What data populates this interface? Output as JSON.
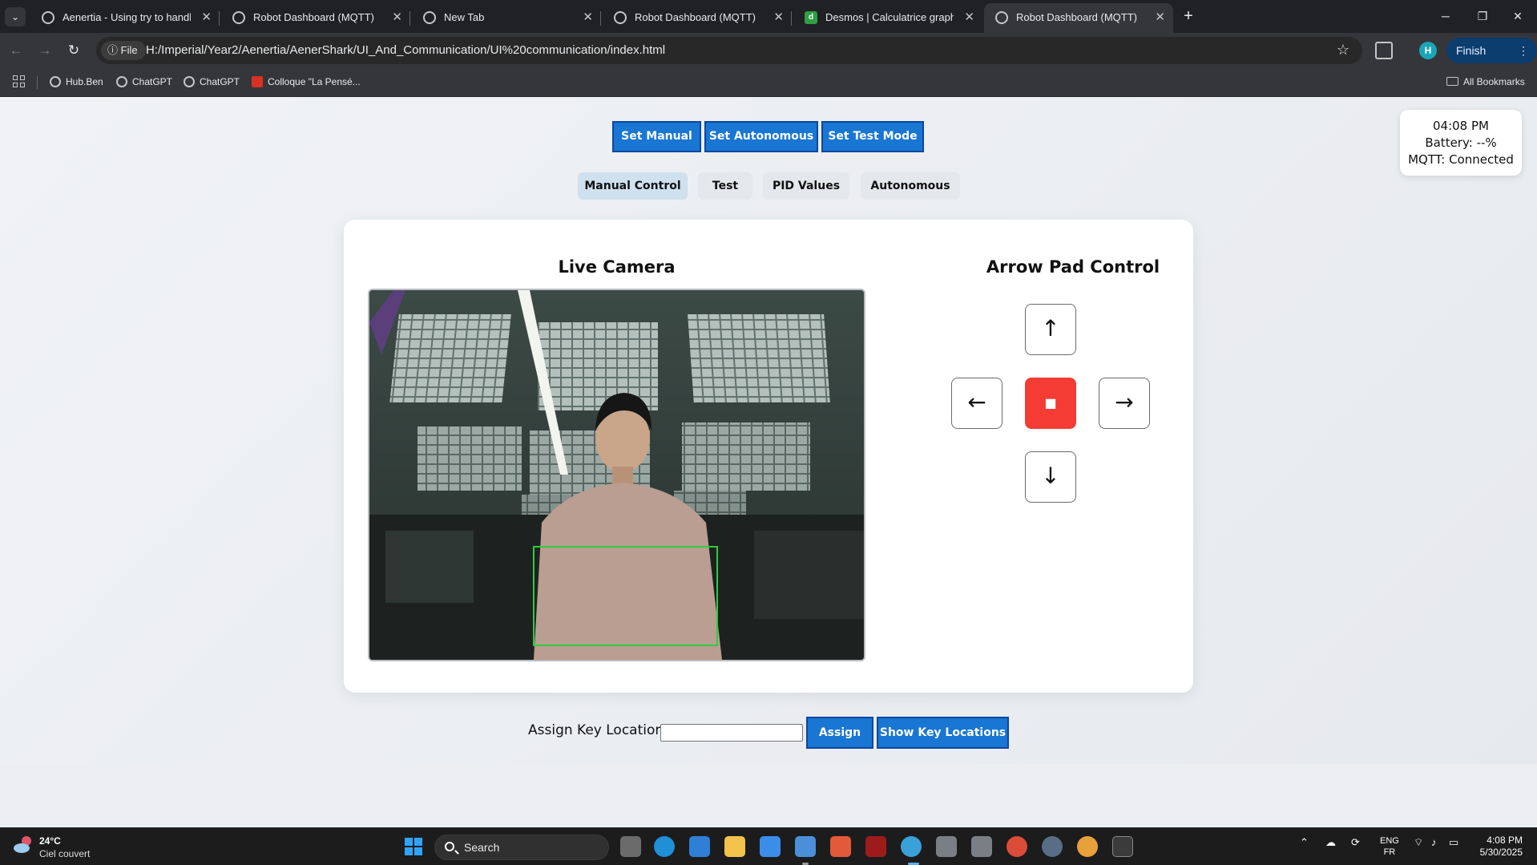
{
  "browser": {
    "tabs": [
      {
        "title": "Aenertia - Using try to handle e",
        "favicon": "chatgpt-icon",
        "active": false
      },
      {
        "title": "Robot Dashboard (MQTT)",
        "favicon": "globe-icon",
        "active": false
      },
      {
        "title": "New Tab",
        "favicon": "chrome-icon",
        "active": false
      },
      {
        "title": "Robot Dashboard (MQTT)",
        "favicon": "globe-icon",
        "active": false
      },
      {
        "title": "Desmos | Calculatrice graphique",
        "favicon": "desmos-icon",
        "active": false
      },
      {
        "title": "Robot Dashboard (MQTT)",
        "favicon": "globe-icon",
        "active": true
      }
    ],
    "file_chip": "File",
    "url": "H:/Imperial/Year2/Aenertia/AenerShark/UI_And_Communication/UI%20communication/index.html",
    "profile_initial": "H",
    "update_button": "Finish update",
    "bookmarks": [
      "Hub.Ben",
      "ChatGPT",
      "ChatGPT",
      "Colloque \"La Pensé..."
    ],
    "all_bookmarks": "All Bookmarks"
  },
  "dashboard": {
    "mode_buttons": [
      "Set Manual",
      "Set Autonomous",
      "Set Test Mode"
    ],
    "tabs": [
      "Manual Control",
      "Test",
      "PID Values",
      "Autonomous"
    ],
    "active_tab": "Manual Control",
    "status": {
      "time": "04:08 PM",
      "battery": "Battery: --%",
      "mqtt": "MQTT: Connected"
    },
    "camera_title": "Live Camera",
    "arrow_title": "Arrow Pad Control",
    "arrows": {
      "up": "↑",
      "left": "←",
      "stop": "■",
      "right": "→",
      "down": "↓"
    },
    "assign_label": "Assign Key Location:",
    "assign_input_value": "",
    "assign_button": "Assign",
    "show_keys_button": "Show Key Locations",
    "colors": {
      "primary_button": "#1976d2",
      "stop_button": "#f43c34",
      "active_tab": "#cfe0ee"
    }
  },
  "taskbar": {
    "weather_temp": "24°C",
    "weather_desc": "Ciel couvert",
    "search_placeholder": "Search",
    "lang_top": "ENG",
    "lang_bottom": "FR",
    "time": "4:08 PM",
    "date": "5/30/2025"
  }
}
